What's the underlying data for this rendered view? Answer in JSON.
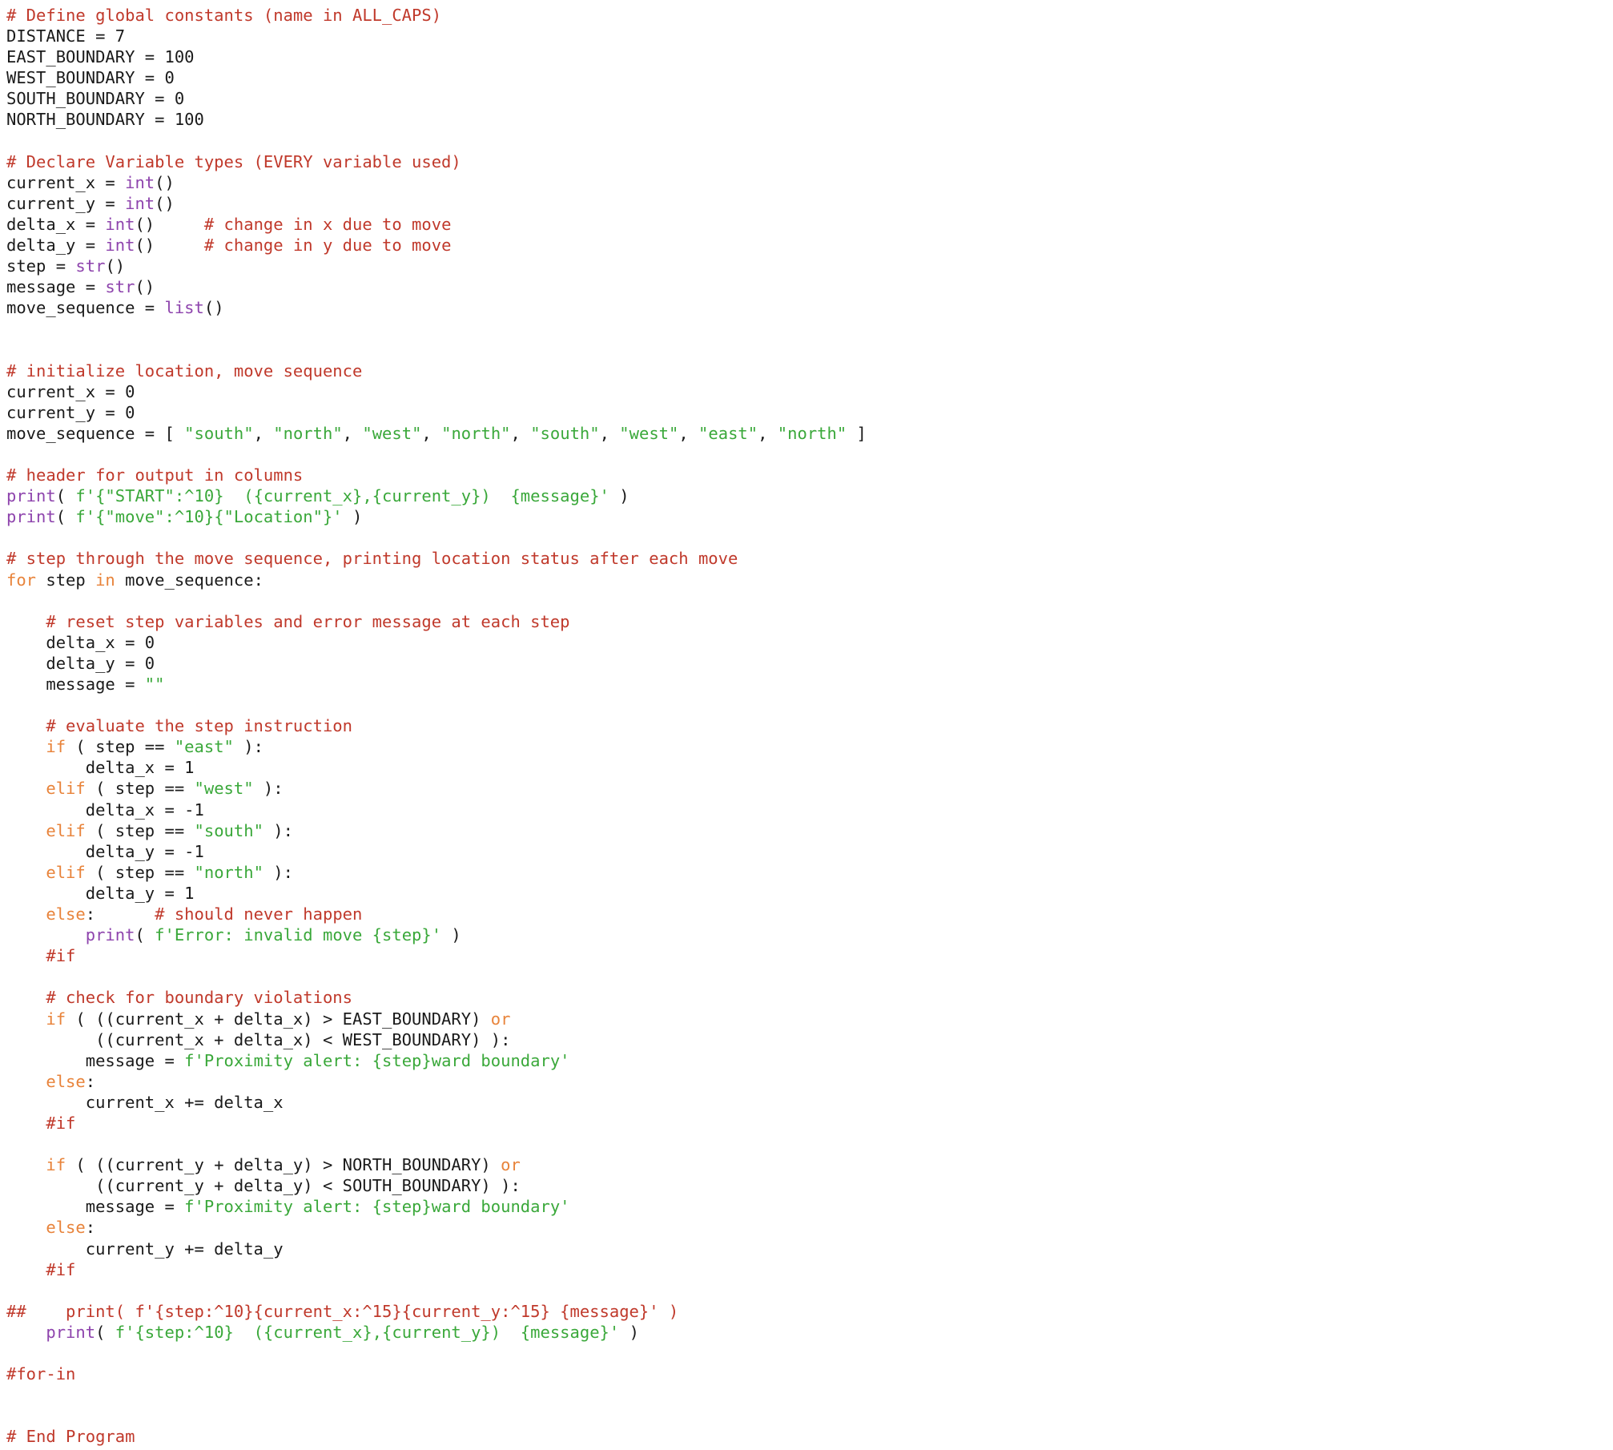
{
  "document": {
    "language": "python",
    "title": "movement simulation program",
    "theme": {
      "background": "#ffffff",
      "default_text": "#1a1a1a",
      "comment": "#c0392b",
      "keyword": "#e8833a",
      "builtin": "#8e44ad",
      "string": "#3aa83a"
    }
  },
  "code": {
    "lines": [
      [
        {
          "t": "# Define global constants (name in ALL_CAPS)",
          "c": "cm"
        }
      ],
      [
        {
          "t": "DISTANCE = 7",
          "c": "df"
        }
      ],
      [
        {
          "t": "EAST_BOUNDARY = 100",
          "c": "df"
        }
      ],
      [
        {
          "t": "WEST_BOUNDARY = 0",
          "c": "df"
        }
      ],
      [
        {
          "t": "SOUTH_BOUNDARY = 0",
          "c": "df"
        }
      ],
      [
        {
          "t": "NORTH_BOUNDARY = 100",
          "c": "df"
        }
      ],
      [],
      [
        {
          "t": "# Declare Variable types (EVERY variable used)",
          "c": "cm"
        }
      ],
      [
        {
          "t": "current_x = ",
          "c": "df"
        },
        {
          "t": "int",
          "c": "bi"
        },
        {
          "t": "()",
          "c": "df"
        }
      ],
      [
        {
          "t": "current_y = ",
          "c": "df"
        },
        {
          "t": "int",
          "c": "bi"
        },
        {
          "t": "()",
          "c": "df"
        }
      ],
      [
        {
          "t": "delta_x = ",
          "c": "df"
        },
        {
          "t": "int",
          "c": "bi"
        },
        {
          "t": "()     ",
          "c": "df"
        },
        {
          "t": "# change in x due to move",
          "c": "cm"
        }
      ],
      [
        {
          "t": "delta_y = ",
          "c": "df"
        },
        {
          "t": "int",
          "c": "bi"
        },
        {
          "t": "()     ",
          "c": "df"
        },
        {
          "t": "# change in y due to move",
          "c": "cm"
        }
      ],
      [
        {
          "t": "step = ",
          "c": "df"
        },
        {
          "t": "str",
          "c": "bi"
        },
        {
          "t": "()",
          "c": "df"
        }
      ],
      [
        {
          "t": "message = ",
          "c": "df"
        },
        {
          "t": "str",
          "c": "bi"
        },
        {
          "t": "()",
          "c": "df"
        }
      ],
      [
        {
          "t": "move_sequence = ",
          "c": "df"
        },
        {
          "t": "list",
          "c": "bi"
        },
        {
          "t": "()",
          "c": "df"
        }
      ],
      [],
      [],
      [
        {
          "t": "# initialize location, move sequence",
          "c": "cm"
        }
      ],
      [
        {
          "t": "current_x = 0",
          "c": "df"
        }
      ],
      [
        {
          "t": "current_y = 0",
          "c": "df"
        }
      ],
      [
        {
          "t": "move_sequence = [ ",
          "c": "df"
        },
        {
          "t": "\"south\"",
          "c": "st"
        },
        {
          "t": ", ",
          "c": "df"
        },
        {
          "t": "\"north\"",
          "c": "st"
        },
        {
          "t": ", ",
          "c": "df"
        },
        {
          "t": "\"west\"",
          "c": "st"
        },
        {
          "t": ", ",
          "c": "df"
        },
        {
          "t": "\"north\"",
          "c": "st"
        },
        {
          "t": ", ",
          "c": "df"
        },
        {
          "t": "\"south\"",
          "c": "st"
        },
        {
          "t": ", ",
          "c": "df"
        },
        {
          "t": "\"west\"",
          "c": "st"
        },
        {
          "t": ", ",
          "c": "df"
        },
        {
          "t": "\"east\"",
          "c": "st"
        },
        {
          "t": ", ",
          "c": "df"
        },
        {
          "t": "\"north\"",
          "c": "st"
        },
        {
          "t": " ]",
          "c": "df"
        }
      ],
      [],
      [
        {
          "t": "# header for output in columns",
          "c": "cm"
        }
      ],
      [
        {
          "t": "print",
          "c": "bi"
        },
        {
          "t": "( ",
          "c": "df"
        },
        {
          "t": "f'{\"START\":^10}  ({current_x},{current_y})  {message}'",
          "c": "st"
        },
        {
          "t": " )",
          "c": "df"
        }
      ],
      [
        {
          "t": "print",
          "c": "bi"
        },
        {
          "t": "( ",
          "c": "df"
        },
        {
          "t": "f'{\"move\":^10}{\"Location\"}'",
          "c": "st"
        },
        {
          "t": " )",
          "c": "df"
        }
      ],
      [],
      [
        {
          "t": "# step through the move sequence, printing location status after each move",
          "c": "cm"
        }
      ],
      [
        {
          "t": "for",
          "c": "kw"
        },
        {
          "t": " step ",
          "c": "df"
        },
        {
          "t": "in",
          "c": "kw"
        },
        {
          "t": " move_sequence:",
          "c": "df"
        }
      ],
      [],
      [
        {
          "t": "    # reset step variables and error message at each step",
          "c": "cm"
        }
      ],
      [
        {
          "t": "    delta_x = 0",
          "c": "df"
        }
      ],
      [
        {
          "t": "    delta_y = 0",
          "c": "df"
        }
      ],
      [
        {
          "t": "    message = ",
          "c": "df"
        },
        {
          "t": "\"\"",
          "c": "st"
        }
      ],
      [],
      [
        {
          "t": "    # evaluate the step instruction",
          "c": "cm"
        }
      ],
      [
        {
          "t": "    ",
          "c": "df"
        },
        {
          "t": "if",
          "c": "kw"
        },
        {
          "t": " ( step == ",
          "c": "df"
        },
        {
          "t": "\"east\"",
          "c": "st"
        },
        {
          "t": " ):",
          "c": "df"
        }
      ],
      [
        {
          "t": "        delta_x = 1",
          "c": "df"
        }
      ],
      [
        {
          "t": "    ",
          "c": "df"
        },
        {
          "t": "elif",
          "c": "kw"
        },
        {
          "t": " ( step == ",
          "c": "df"
        },
        {
          "t": "\"west\"",
          "c": "st"
        },
        {
          "t": " ):",
          "c": "df"
        }
      ],
      [
        {
          "t": "        delta_x = -1",
          "c": "df"
        }
      ],
      [
        {
          "t": "    ",
          "c": "df"
        },
        {
          "t": "elif",
          "c": "kw"
        },
        {
          "t": " ( step == ",
          "c": "df"
        },
        {
          "t": "\"south\"",
          "c": "st"
        },
        {
          "t": " ):",
          "c": "df"
        }
      ],
      [
        {
          "t": "        delta_y = -1",
          "c": "df"
        }
      ],
      [
        {
          "t": "    ",
          "c": "df"
        },
        {
          "t": "elif",
          "c": "kw"
        },
        {
          "t": " ( step == ",
          "c": "df"
        },
        {
          "t": "\"north\"",
          "c": "st"
        },
        {
          "t": " ):",
          "c": "df"
        }
      ],
      [
        {
          "t": "        delta_y = 1",
          "c": "df"
        }
      ],
      [
        {
          "t": "    ",
          "c": "df"
        },
        {
          "t": "else",
          "c": "kw"
        },
        {
          "t": ":      ",
          "c": "df"
        },
        {
          "t": "# should never happen",
          "c": "cm"
        }
      ],
      [
        {
          "t": "        ",
          "c": "df"
        },
        {
          "t": "print",
          "c": "bi"
        },
        {
          "t": "( ",
          "c": "df"
        },
        {
          "t": "f'Error: invalid move {step}'",
          "c": "st"
        },
        {
          "t": " )",
          "c": "df"
        }
      ],
      [
        {
          "t": "    #if",
          "c": "cm"
        }
      ],
      [],
      [
        {
          "t": "    # check for boundary violations",
          "c": "cm"
        }
      ],
      [
        {
          "t": "    ",
          "c": "df"
        },
        {
          "t": "if",
          "c": "kw"
        },
        {
          "t": " ( ((current_x + delta_x) > EAST_BOUNDARY) ",
          "c": "df"
        },
        {
          "t": "or",
          "c": "kw"
        }
      ],
      [
        {
          "t": "         ((current_x + delta_x) < WEST_BOUNDARY) ):",
          "c": "df"
        }
      ],
      [
        {
          "t": "        message = ",
          "c": "df"
        },
        {
          "t": "f'Proximity alert: {step}ward boundary'",
          "c": "st"
        }
      ],
      [
        {
          "t": "    ",
          "c": "df"
        },
        {
          "t": "else",
          "c": "kw"
        },
        {
          "t": ":",
          "c": "df"
        }
      ],
      [
        {
          "t": "        current_x += delta_x",
          "c": "df"
        }
      ],
      [
        {
          "t": "    #if",
          "c": "cm"
        }
      ],
      [],
      [
        {
          "t": "    ",
          "c": "df"
        },
        {
          "t": "if",
          "c": "kw"
        },
        {
          "t": " ( ((current_y + delta_y) > NORTH_BOUNDARY) ",
          "c": "df"
        },
        {
          "t": "or",
          "c": "kw"
        }
      ],
      [
        {
          "t": "         ((current_y + delta_y) < SOUTH_BOUNDARY) ):",
          "c": "df"
        }
      ],
      [
        {
          "t": "        message = ",
          "c": "df"
        },
        {
          "t": "f'Proximity alert: {step}ward boundary'",
          "c": "st"
        }
      ],
      [
        {
          "t": "    ",
          "c": "df"
        },
        {
          "t": "else",
          "c": "kw"
        },
        {
          "t": ":",
          "c": "df"
        }
      ],
      [
        {
          "t": "        current_y += delta_y",
          "c": "df"
        }
      ],
      [
        {
          "t": "    #if",
          "c": "cm"
        }
      ],
      [],
      [
        {
          "t": "##    print( f'{step:^10}{current_x:^15}{current_y:^15} {message}' )",
          "c": "cm"
        }
      ],
      [
        {
          "t": "    ",
          "c": "df"
        },
        {
          "t": "print",
          "c": "bi"
        },
        {
          "t": "( ",
          "c": "df"
        },
        {
          "t": "f'{step:^10}  ({current_x},{current_y})  {message}'",
          "c": "st"
        },
        {
          "t": " )",
          "c": "df"
        }
      ],
      [],
      [
        {
          "t": "#for-in",
          "c": "cm"
        }
      ],
      [],
      [],
      [
        {
          "t": "# End Program",
          "c": "cm"
        }
      ]
    ]
  }
}
